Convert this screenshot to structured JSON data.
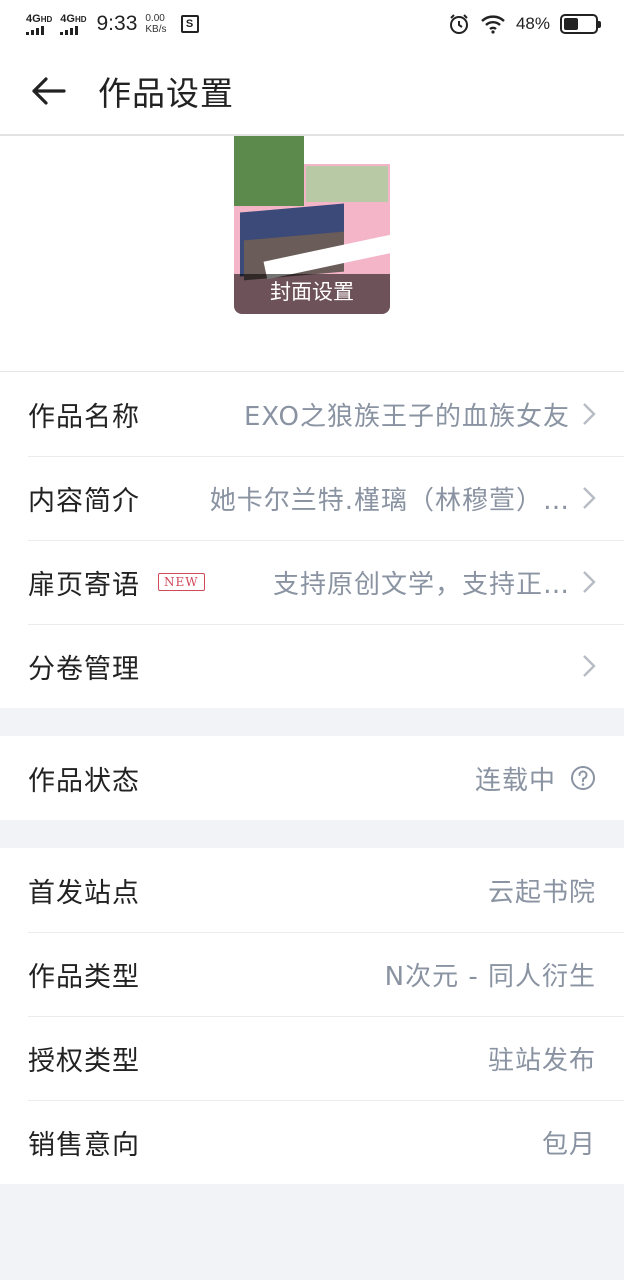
{
  "status_bar": {
    "sim1": "4G",
    "sim1_sup": "HD",
    "sim2": "4G",
    "sim2_sup": "HD",
    "time": "9:33",
    "speed_value": "0.00",
    "speed_unit": "KB/s",
    "sim_icon_letter": "S",
    "battery_percent": "48%",
    "battery_level": 0.48
  },
  "header": {
    "title": "作品设置"
  },
  "cover": {
    "label": "封面设置"
  },
  "info_group": [
    {
      "label": "作品名称",
      "value": "EXO之狼族王子的血族女友"
    },
    {
      "label": "内容简介",
      "value": "她卡尔兰特.槿璃（林穆萱）…"
    },
    {
      "label": "扉页寄语",
      "badge": "NEW",
      "value": "支持原创文学，支持正…"
    },
    {
      "label": "分卷管理",
      "value": ""
    }
  ],
  "status_row": {
    "label": "作品状态",
    "value": "连载中"
  },
  "meta_group": [
    {
      "label": "首发站点",
      "value": "云起书院"
    },
    {
      "label": "作品类型",
      "value": "N次元 - 同人衍生"
    },
    {
      "label": "授权类型",
      "value": "驻站发布"
    },
    {
      "label": "销售意向",
      "value": "包月"
    }
  ],
  "colors": {
    "background": "#f1f3f6",
    "value_text": "#8a93a2",
    "badge": "#d04a5a"
  }
}
